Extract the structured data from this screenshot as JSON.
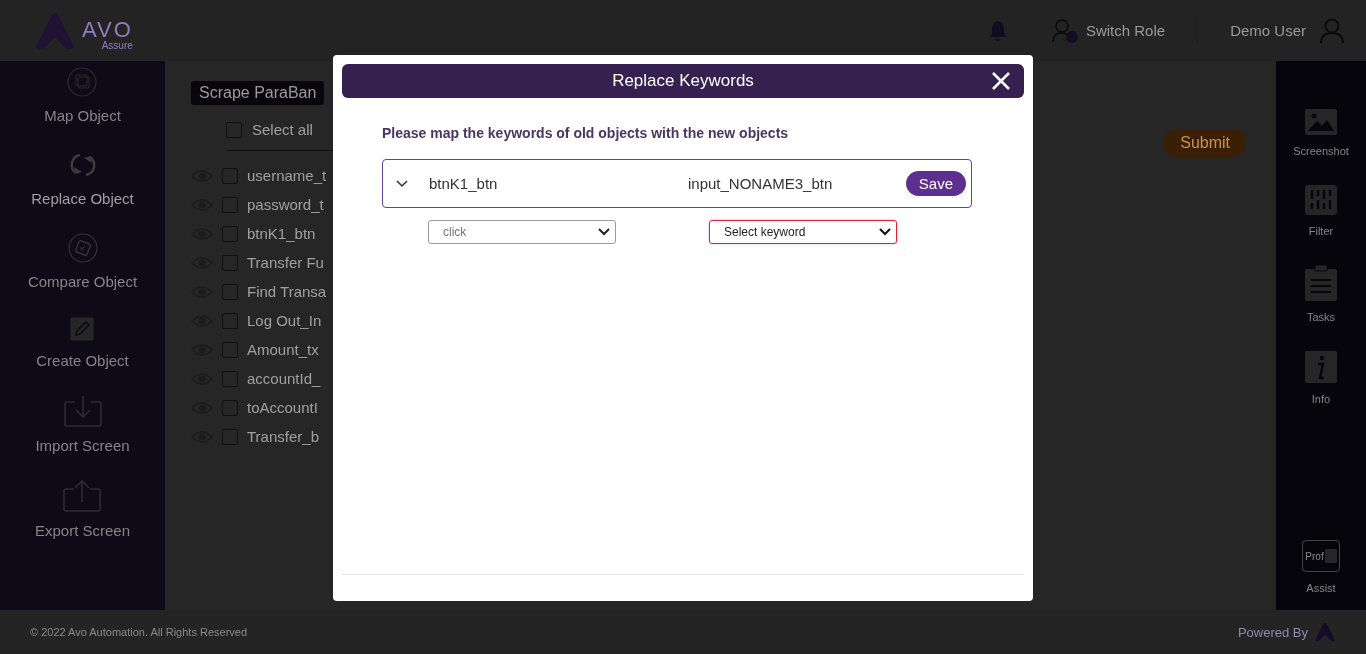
{
  "header": {
    "logo": {
      "name": "AVO",
      "subtitle": "Assure"
    },
    "switch_role": "Switch Role",
    "user": "Demo User"
  },
  "left_nav": [
    {
      "kind": "map",
      "label": "Map Object"
    },
    {
      "kind": "replace",
      "label": "Replace Object"
    },
    {
      "kind": "compare",
      "label": "Compare Object"
    },
    {
      "kind": "create",
      "label": "Create Object"
    },
    {
      "kind": "import",
      "label": "Import Screen"
    },
    {
      "kind": "export",
      "label": "Export Screen"
    }
  ],
  "content": {
    "title": "Scrape ParaBan",
    "select_all": {
      "label": "Select all",
      "checked": false
    },
    "submit": "Submit",
    "objects": [
      {
        "label": "username_t",
        "checked": false
      },
      {
        "label": "password_t",
        "checked": false
      },
      {
        "label": "btnK1_btn",
        "checked": false
      },
      {
        "label": "Transfer Fu",
        "checked": false
      },
      {
        "label": "Find Transa",
        "checked": false
      },
      {
        "label": "Log Out_In",
        "checked": false
      },
      {
        "label": "Amount_tx",
        "checked": false
      },
      {
        "label": "accountId_",
        "checked": false
      },
      {
        "label": "toAccountI",
        "checked": false
      },
      {
        "label": "Transfer_b",
        "checked": false
      }
    ]
  },
  "right_nav": [
    {
      "kind": "screenshot",
      "label": "Screenshot"
    },
    {
      "kind": "filter",
      "label": "Filter"
    },
    {
      "kind": "tasks",
      "label": "Tasks"
    },
    {
      "kind": "info",
      "label": "Info"
    },
    {
      "kind": "assist",
      "label": "Assist",
      "icon_text": "Prof"
    }
  ],
  "footer": {
    "copyright": "© 2022 Avo Automation. All Rights Reserved",
    "powered_by": "Powered By"
  },
  "modal": {
    "title": "Replace Keywords",
    "instruction": "Please map the keywords of old objects with the new objects",
    "mappings": [
      {
        "expanded": true,
        "old_object": "btnK1_btn",
        "new_object": "input_NONAME3_btn",
        "save": "Save",
        "old_keyword": "click",
        "new_keyword": {
          "placeholder": "Select keyword",
          "invalid": true
        }
      }
    ]
  }
}
